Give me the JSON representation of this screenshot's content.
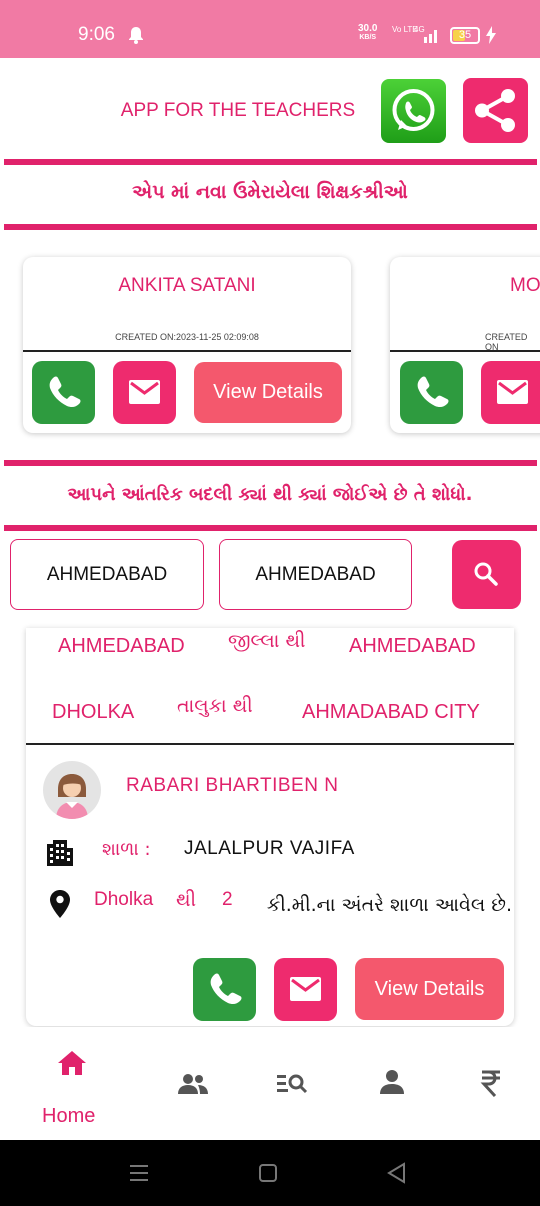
{
  "status_bar": {
    "time": "9:06",
    "net_speed": "30.0",
    "net_unit": "KB/S",
    "volte": "Vo LTE",
    "signal": "4G",
    "battery": "35"
  },
  "header": {
    "app_title": "APP FOR THE TEACHERS"
  },
  "banners": {
    "new_teachers": "એપ માં નવા ઉમેરાયેલા શિક્ષકશ્રીઓ",
    "search_hint": "આપને આંતરિક બદલી ક્યાં થી ક્યાં જોઈએ છે તે શોધો."
  },
  "carousel": {
    "cards": [
      {
        "name": "ANKITA SATANI",
        "created": "CREATED ON:2023-11-25 02:09:08",
        "view_label": "View Details"
      },
      {
        "name": "MO",
        "created": "CREATED ON"
      }
    ]
  },
  "search": {
    "from": "AHMEDABAD",
    "to": "AHMEDABAD"
  },
  "result": {
    "from_district": "AHMEDABAD",
    "district_label": "જીલ્લા થી",
    "to_district": "AHMEDABAD",
    "from_taluka": "DHOLKA",
    "taluka_label": "તાલુકા થી",
    "to_taluka": "AHMADABAD CITY",
    "teacher_name": "RABARI BHARTIBEN N",
    "school_label": "શાળા :",
    "school_name": "JALALPUR VAJIFA",
    "place": "Dholka",
    "from_word": "થી",
    "distance": "2",
    "distance_suffix": "કી.મી.ના અંતરે શાળા આવેલ છે.",
    "view_label": "View Details"
  },
  "bottom_nav": {
    "home_label": "Home"
  },
  "colors": {
    "primary": "#e0226b",
    "status_bar": "#f17aa4",
    "call_green": "#2e9b3f",
    "view_button": "#f4586d"
  }
}
